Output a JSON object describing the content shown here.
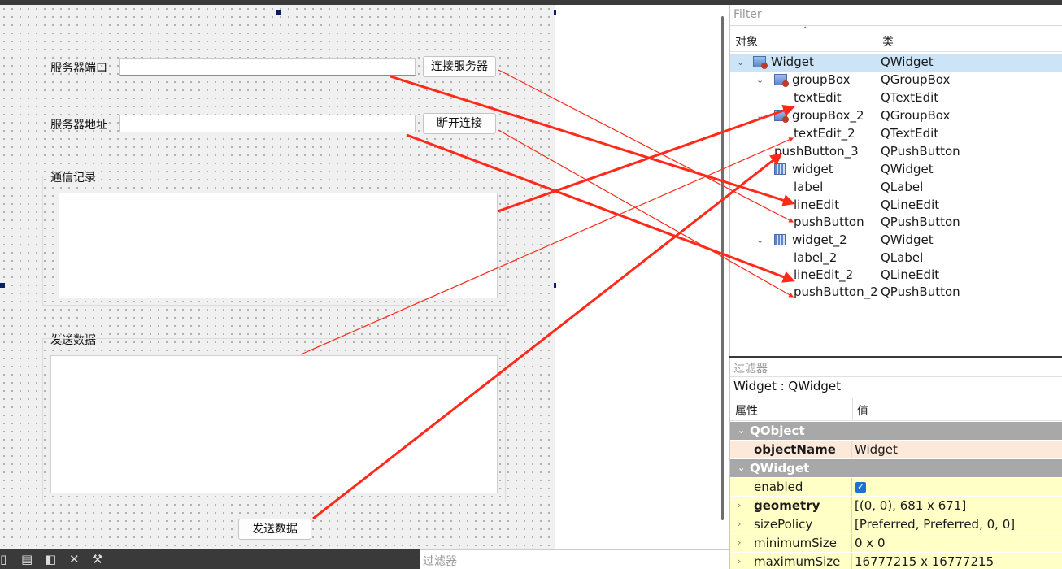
{
  "form": {
    "port_label": "服务器端口",
    "connect_button": "连接服务器",
    "address_label": "服务器地址",
    "disconnect_button": "断开连接",
    "log_group_title": "通信记录",
    "send_group_title": "发送数据",
    "send_button": "发送数据"
  },
  "object_inspector": {
    "filter_placeholder": "Filter",
    "col_object": "对象",
    "col_class": "类",
    "rows": [
      {
        "name": "Widget",
        "class": "QWidget",
        "icon": "widget-icon",
        "expanded": true,
        "selected": true
      },
      {
        "name": "groupBox",
        "class": "QGroupBox",
        "icon": "groupbox-icon",
        "expanded": true
      },
      {
        "name": "textEdit",
        "class": "QTextEdit"
      },
      {
        "name": "groupBox_2",
        "class": "QGroupBox",
        "icon": "groupbox-icon",
        "expanded": true
      },
      {
        "name": "textEdit_2",
        "class": "QTextEdit"
      },
      {
        "name": "pushButton_3",
        "class": "QPushButton"
      },
      {
        "name": "widget",
        "class": "QWidget",
        "icon": "layout-icon",
        "expanded": true
      },
      {
        "name": "label",
        "class": "QLabel"
      },
      {
        "name": "lineEdit",
        "class": "QLineEdit"
      },
      {
        "name": "pushButton",
        "class": "QPushButton"
      },
      {
        "name": "widget_2",
        "class": "QWidget",
        "icon": "layout-icon",
        "expanded": true
      },
      {
        "name": "label_2",
        "class": "QLabel"
      },
      {
        "name": "lineEdit_2",
        "class": "QLineEdit"
      },
      {
        "name": "pushButton_2",
        "class": "QPushButton"
      }
    ]
  },
  "property_editor": {
    "filter_placeholder": "过滤器",
    "object_title": "Widget : QWidget",
    "col_property": "属性",
    "col_value": "值",
    "sections": {
      "qobject": "QObject",
      "qwidget": "QWidget"
    },
    "props": {
      "objectName": {
        "key": "objectName",
        "value": "Widget"
      },
      "enabled": {
        "key": "enabled",
        "checked": true
      },
      "geometry": {
        "key": "geometry",
        "value": "[(0, 0), 681 x 671]"
      },
      "sizePolicy": {
        "key": "sizePolicy",
        "value": "[Preferred, Preferred, 0, 0]"
      },
      "minimumSize": {
        "key": "minimumSize",
        "value": "0 x 0"
      },
      "maximumSize": {
        "key": "maximumSize",
        "value": "16777215 x 16777215"
      }
    }
  },
  "bottom": {
    "filter_placeholder": "过滤器",
    "icons": [
      "new-file-icon",
      "book-icon",
      "resource-icon",
      "close-doc-icon",
      "wrench-icon"
    ]
  },
  "colors": {
    "annotation_arrow": "#ff2a1a",
    "selection": "#cce4f7",
    "section_header": "#a8a8a8",
    "designer_background": "#f0f0f0"
  }
}
